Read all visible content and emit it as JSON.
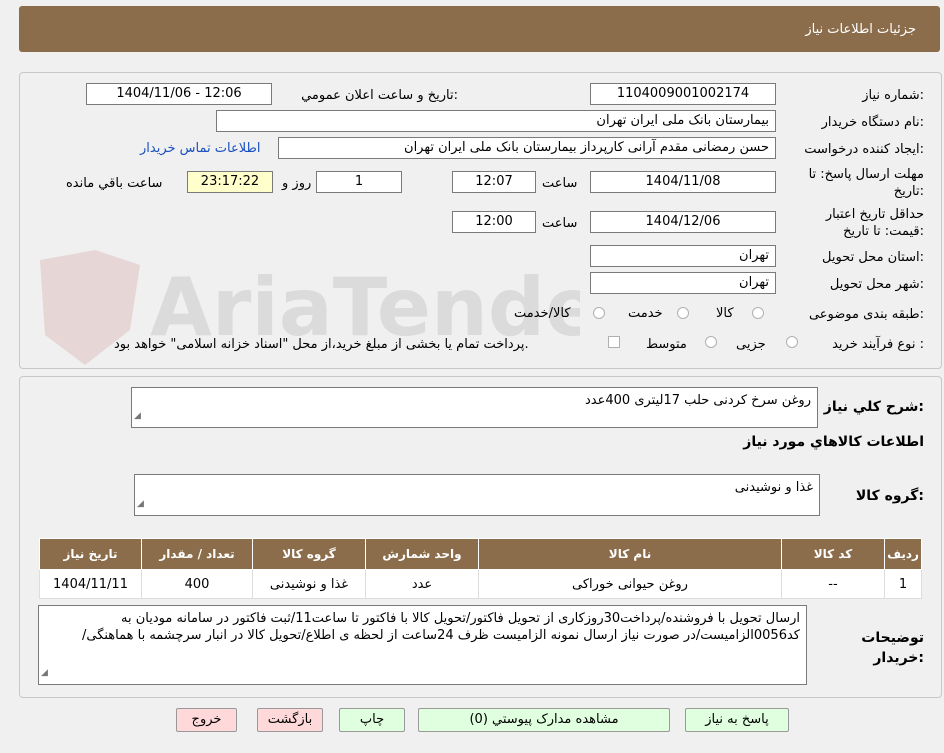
{
  "header": {
    "title": "جزئیات اطلاعات نیاز"
  },
  "form": {
    "need_number_label": "شماره نیاز:",
    "need_number": "1104009001002174",
    "announce_label": "تاریخ و ساعت اعلان عمومي:",
    "announce_value": "1404/11/06 - 12:06",
    "buyer_label": "نام دستگاه خریدار:",
    "buyer_value": "بیمارستان بانک ملی ایران تهران",
    "creator_label": "ایجاد کننده درخواست:",
    "creator_value": "حسن رمضانی مقدم آرانی کارپرداز بیمارستان بانک ملی ایران تهران",
    "contact_link": "اطلاعات تماس خریدار",
    "deadline_label": "مهلت ارسال پاسخ: تا تاریخ:",
    "deadline_date": "1404/11/08",
    "time_label": "ساعت",
    "deadline_time": "12:07",
    "days_value": "1",
    "days_label": "روز و",
    "remaining_time": "23:17:22",
    "remaining_label": "ساعت باقي مانده",
    "validity_label": "حداقل تاریخ اعتبار قیمت: تا تاریخ:",
    "validity_date": "1404/12/06",
    "validity_time": "12:00",
    "province_label": "استان محل تحویل:",
    "province_value": "تهران",
    "city_label": "شهر محل تحویل:",
    "city_value": "تهران",
    "category_label": "طبقه بندی موضوعی:",
    "category_options": [
      "کالا",
      "خدمت",
      "کالا/خدمت"
    ],
    "process_label": "نوع فرآیند خرید :",
    "process_options": [
      "جزیی",
      "متوسط"
    ],
    "payment_note": "پرداخت تمام یا بخشی از مبلغ خرید،از محل \"اسناد خزانه اسلامی\" خواهد بود."
  },
  "summary": {
    "general_label": "شرح کلي نياز:",
    "general_value": "روغن سرخ کردنی حلب 17لیتری 400عدد",
    "goods_info_title": "اطلاعات کالاهاي مورد نياز",
    "group_label": "گروه کالا:",
    "group_value": "غذا و نوشیدنی",
    "table": {
      "headers": [
        "رديف",
        "کد کالا",
        "نام کالا",
        "واحد شمارش",
        "گروه کالا",
        "تعداد / مقدار",
        "تاریخ نیاز"
      ],
      "rows": [
        [
          "1",
          "--",
          "روغن حیوانی خوراکی",
          "عدد",
          "غذا و نوشیدنی",
          "400",
          "1404/11/11"
        ]
      ]
    },
    "buyer_notes_label": "توضيحات خريدار:",
    "buyer_notes": "ارسال تحویل با فروشنده/پرداخت30روزکاری از تحویل فاکتور/تحویل کالا با فاکتور تا ساعت11/ثبت فاکتور در سامانه مودیان به کد0056الزامیست/در صورت نیاز ارسال نمونه الزامیست ظرف 24ساعت از لحظه ی اطلاع/تحویل کالا در انبار سرچشمه با هماهنگی/"
  },
  "buttons": {
    "reply": "پاسخ به نياز",
    "view_docs": "مشاهده مدارک پيوستي (0)",
    "print": "چاپ",
    "back": "بازگشت",
    "exit": "خروج"
  },
  "watermark": {
    "text": "AriaTender.net"
  },
  "colors": {
    "header_bg": "#8b6d4c",
    "link": "#1a4fc0",
    "button_green": "#dfffdf",
    "button_red": "#ffd9d9",
    "highlight": "#ffffcc"
  }
}
